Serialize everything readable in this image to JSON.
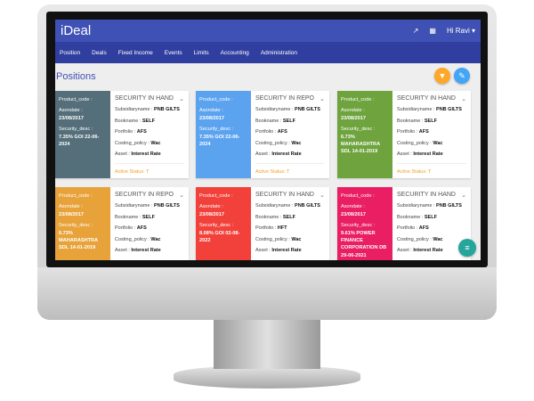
{
  "app": {
    "title": "iDeal",
    "user": "Hi Ravi",
    "icons": [
      "chart-icon",
      "grid-icon"
    ]
  },
  "nav": [
    "Position",
    "Deals",
    "Fixed Income",
    "Events",
    "Limits",
    "Accounting",
    "Administration"
  ],
  "page": {
    "title": "Positions"
  },
  "labels": {
    "product_code": "Product_code :",
    "asondate": "Asondate :",
    "security_desc": "Security_desc :",
    "subsidiary": "Subsidiaryname : ",
    "bookname": "Bookname : ",
    "portfolio": "Portfolio : ",
    "costing": "Costing_policy : ",
    "asset": "Asset : "
  },
  "colors": {
    "header": "#3f51b5",
    "nav": "#303f9f",
    "filter_fab": "#ffa726",
    "edit_fab": "#42a5f5",
    "menu_fab": "#26a69a"
  },
  "cards": [
    {
      "color": "#546e7a",
      "asondate": "23/08/2017",
      "security_desc": "7.35% GOI 22-06-2024",
      "title": "SECURITY IN HAND",
      "subsidiary": "PNB GILTS",
      "bookname": "SELF",
      "portfolio": "AFS",
      "costing": "Wac",
      "asset": "Interest Rate",
      "status": "Active Status: T"
    },
    {
      "color": "#5ca3ef",
      "asondate": "23/08/2017",
      "security_desc": "7.35% GOI 22-06-2024",
      "title": "SECURITY IN REPO",
      "subsidiary": "PNB GILTS",
      "bookname": "SELF",
      "portfolio": "AFS",
      "costing": "Wac",
      "asset": "Interest Rate",
      "status": "Active Status: T"
    },
    {
      "color": "#6ea33e",
      "asondate": "23/08/2017",
      "security_desc": "6.73% MAHARASHTRA SDL 14-01-2019",
      "title": "SECURITY IN HAND",
      "subsidiary": "PNB GILTS",
      "bookname": "SELF",
      "portfolio": "AFS",
      "costing": "Wac",
      "asset": "Interest Rate",
      "status": "Active Status: T"
    },
    {
      "color": "#e8a23a",
      "asondate": "23/08/2017",
      "security_desc": "6.73% MAHARASHTRA SDL 14-01-2019",
      "title": "SECURITY IN REPO",
      "subsidiary": "PNB GILTS",
      "bookname": "SELF",
      "portfolio": "AFS",
      "costing": "Wac",
      "asset": "Interest Rate"
    },
    {
      "color": "#f2413a",
      "asondate": "23/08/2017",
      "security_desc": "8.08% GOI 02-08-2022",
      "title": "SECURITY IN HAND",
      "subsidiary": "PNB GILTS",
      "bookname": "SELF",
      "portfolio": "HFT",
      "costing": "Wac",
      "asset": "Interest Rate"
    },
    {
      "color": "#e91e63",
      "asondate": "23/08/2017",
      "security_desc": "9.61% POWER FINANCE CORPORATION DB 29-06-2021",
      "title": "SECURITY IN HAND",
      "subsidiary": "PNB GILTS",
      "bookname": "SELF",
      "portfolio": "AFS",
      "costing": "Wac",
      "asset": "Interest Rate"
    }
  ]
}
